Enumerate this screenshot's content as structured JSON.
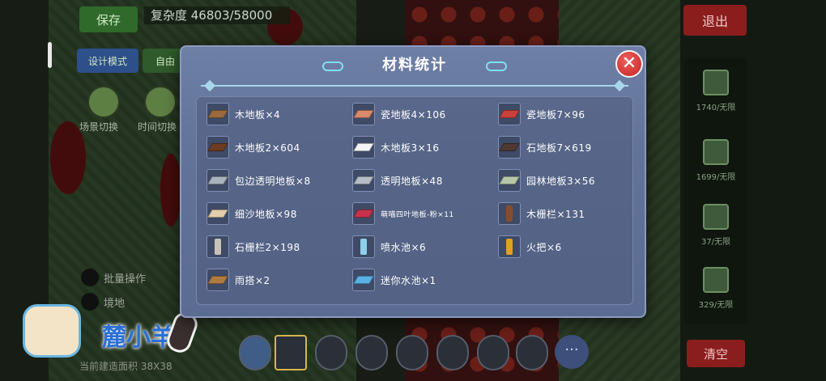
{
  "hud": {
    "save_label": "保存",
    "complexity_text": "复杂度 46803/58000",
    "design_mode_label": "设计模式",
    "free_mode_label": "自由",
    "exit_label": "退出",
    "clear_label": "清空",
    "scene_switch_label": "场景切换",
    "time_switch_label": "时间切换",
    "batch_label": "批量操作",
    "wall_label": "境地",
    "area_label": "当前建造面积 38X38"
  },
  "side_panel": {
    "counts": [
      "1740/无限",
      "1699/无限",
      "37/无限",
      "329/无限"
    ]
  },
  "dialog": {
    "title": "材料统计",
    "close_label": "✕",
    "items": [
      {
        "label": "木地板×4",
        "icon": "wood-floor-icon",
        "color": "#9b6a3c"
      },
      {
        "label": "瓷地板4×106",
        "icon": "ceramic-floor-icon",
        "color": "#d9886a"
      },
      {
        "label": "瓷地板7×96",
        "icon": "ceramic-floor-red-icon",
        "color": "#c8413a"
      },
      {
        "label": "木地板2×604",
        "icon": "dark-wood-floor-icon",
        "color": "#6e3b24"
      },
      {
        "label": "木地板3×16",
        "icon": "white-floor-icon",
        "color": "#f4f4f4"
      },
      {
        "label": "石地板7×619",
        "icon": "stone-floor-icon",
        "color": "#4e3a33"
      },
      {
        "label": "包边透明地板×8",
        "icon": "glass-floor-edged-icon",
        "color": "#a9b3bd"
      },
      {
        "label": "透明地板×48",
        "icon": "glass-floor-icon",
        "color": "#b4bdc6"
      },
      {
        "label": "园林地板3×56",
        "icon": "garden-floor-icon",
        "color": "#b7c7a8"
      },
      {
        "label": "细沙地板×98",
        "icon": "sand-floor-icon",
        "color": "#e3cfae"
      },
      {
        "label": "萌喵四叶地板-粉×11",
        "icon": "cat-clover-floor-icon",
        "color": "#c8324a"
      },
      {
        "label": "木栅栏×131",
        "icon": "wood-fence-icon",
        "color": "#8a4b2a"
      },
      {
        "label": "石栅栏2×198",
        "icon": "stone-fence-icon",
        "color": "#c9c2b6"
      },
      {
        "label": "喷水池×6",
        "icon": "fountain-icon",
        "color": "#8fd0e8"
      },
      {
        "label": "火把×6",
        "icon": "torch-icon",
        "color": "#e0a020"
      },
      {
        "label": "雨搭×2",
        "icon": "awning-icon",
        "color": "#b07b3e"
      },
      {
        "label": "迷你水池×1",
        "icon": "mini-pool-icon",
        "color": "#5ab0e6"
      }
    ]
  },
  "watermark": {
    "text": "麓小羊"
  },
  "toolbar": {
    "more_label": "···"
  }
}
